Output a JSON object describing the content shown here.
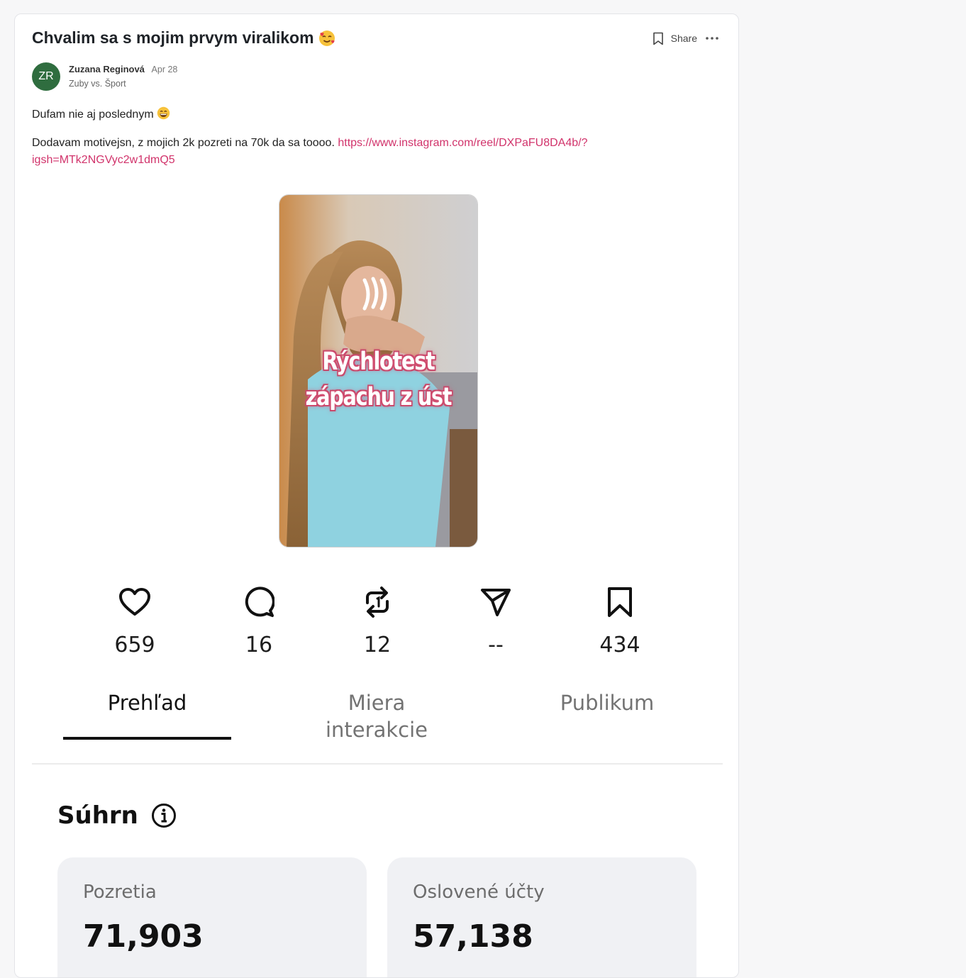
{
  "post": {
    "title": "Chvalim sa s mojim prvym viralikom",
    "title_emoji": "smiling-face-with-hearts",
    "author": {
      "initials": "ZR",
      "name": "Zuzana Reginová",
      "date": "Apr 28",
      "community": "Zuby vs. Šport"
    },
    "actions": {
      "share_label": "Share"
    },
    "paragraph1": "Dufam nie aj poslednym",
    "paragraph1_emoji": "grinning-face",
    "paragraph2_text": "Dodavam motivejsn, z mojich 2k pozreti na 70k da sa toooo.",
    "link_text": "https://www.instagram.com/reel/DXPaFU8DA4b/?igsh=MTk2NGVyc2w1dmQ5"
  },
  "reel": {
    "overlay_line1": "Rýchlotest",
    "overlay_line2": "zápachu z úst"
  },
  "stats": [
    {
      "icon": "heart-icon",
      "value": "659"
    },
    {
      "icon": "comment-icon",
      "value": "16"
    },
    {
      "icon": "repost-icon",
      "value": "12"
    },
    {
      "icon": "send-icon",
      "value": "--"
    },
    {
      "icon": "bookmark-icon",
      "value": "434"
    }
  ],
  "tabs": [
    {
      "label": "Prehľad",
      "active": true
    },
    {
      "label": "Miera interakcie",
      "active": false
    },
    {
      "label": "Publikum",
      "active": false
    }
  ],
  "summary": {
    "title": "Súhrn",
    "metrics": [
      {
        "label": "Pozretia",
        "value": "71,903"
      },
      {
        "label": "Oslovené účty",
        "value": "57,138"
      }
    ]
  },
  "colors": {
    "link": "#d1336b",
    "avatar": "#2f6d3f",
    "metric_card": "#f0f1f4"
  }
}
